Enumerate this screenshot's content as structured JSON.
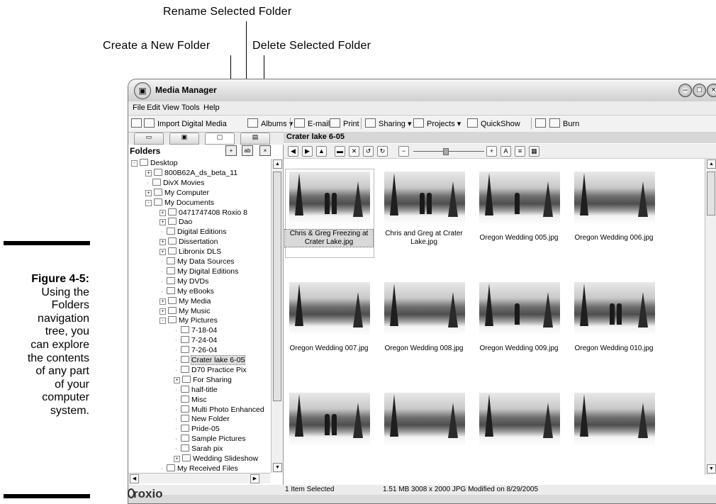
{
  "callouts": {
    "rename": "Rename Selected Folder",
    "create": "Create a New Folder",
    "delete": "Delete Selected Folder"
  },
  "figure": {
    "label": "Figure 4-5:",
    "lines": [
      "Using the",
      "Folders",
      "navigation",
      "tree, you",
      "can explore",
      "the contents",
      "of any part",
      "of your",
      "computer",
      "system."
    ]
  },
  "window": {
    "title": "Media Manager",
    "menu": [
      "File",
      "Edit",
      "View",
      "Tools",
      "Help"
    ],
    "toolbar": [
      "Import Digital Media",
      "Albums",
      "E-mail",
      "Print",
      "Sharing",
      "Projects",
      "QuickShow",
      "Burn"
    ],
    "buttons": {
      "minimize": "–",
      "maximize": "□",
      "close": "×"
    }
  },
  "folders": {
    "header": "Folders",
    "tree": [
      {
        "label": "Desktop",
        "level": 0,
        "exp": "-"
      },
      {
        "label": "800B62A_ds_beta_11",
        "level": 1,
        "exp": "+"
      },
      {
        "label": "DivX Movies",
        "level": 1,
        "exp": ""
      },
      {
        "label": "My Computer",
        "level": 1,
        "exp": "+"
      },
      {
        "label": "My Documents",
        "level": 1,
        "exp": "-"
      },
      {
        "label": "0471747408 Roxio 8",
        "level": 2,
        "exp": "+"
      },
      {
        "label": "Dao",
        "level": 2,
        "exp": "+"
      },
      {
        "label": "Digital Editions",
        "level": 2,
        "exp": ""
      },
      {
        "label": "Dissertation",
        "level": 2,
        "exp": "+"
      },
      {
        "label": "Libronix DLS",
        "level": 2,
        "exp": "+"
      },
      {
        "label": "My Data Sources",
        "level": 2,
        "exp": ""
      },
      {
        "label": "My Digital Editions",
        "level": 2,
        "exp": ""
      },
      {
        "label": "My DVDs",
        "level": 2,
        "exp": ""
      },
      {
        "label": "My eBooks",
        "level": 2,
        "exp": ""
      },
      {
        "label": "My Media",
        "level": 2,
        "exp": "+"
      },
      {
        "label": "My Music",
        "level": 2,
        "exp": "+"
      },
      {
        "label": "My Pictures",
        "level": 2,
        "exp": "-"
      },
      {
        "label": "7-18-04",
        "level": 3,
        "exp": ""
      },
      {
        "label": "7-24-04",
        "level": 3,
        "exp": ""
      },
      {
        "label": "7-26-04",
        "level": 3,
        "exp": ""
      },
      {
        "label": "Crater lake 6-05",
        "level": 3,
        "exp": "",
        "selected": true
      },
      {
        "label": "D70 Practice Pix",
        "level": 3,
        "exp": ""
      },
      {
        "label": "For Sharing",
        "level": 3,
        "exp": "+"
      },
      {
        "label": "half-title",
        "level": 3,
        "exp": ""
      },
      {
        "label": "Misc",
        "level": 3,
        "exp": ""
      },
      {
        "label": "Multi Photo Enhanced",
        "level": 3,
        "exp": ""
      },
      {
        "label": "New Folder",
        "level": 3,
        "exp": ""
      },
      {
        "label": "Pride-05",
        "level": 3,
        "exp": ""
      },
      {
        "label": "Sample Pictures",
        "level": 3,
        "exp": ""
      },
      {
        "label": "Sarah pix",
        "level": 3,
        "exp": ""
      },
      {
        "label": "Wedding Slideshow",
        "level": 3,
        "exp": "+"
      },
      {
        "label": "My Received Files",
        "level": 2,
        "exp": ""
      }
    ]
  },
  "content": {
    "folder_title": "Crater lake 6-05",
    "photos": [
      {
        "caption": "Chris & Greg Freezing at Crater Lake.jpg",
        "selected": true,
        "people": 2
      },
      {
        "caption": "Chris and Greg at Crater Lake.jpg",
        "people": 2
      },
      {
        "caption": "Oregon Wedding 005.jpg",
        "people": 1
      },
      {
        "caption": "Oregon Wedding 006.jpg",
        "people": 0
      },
      {
        "caption": "Oregon Wedding 007.jpg",
        "people": 0
      },
      {
        "caption": "Oregon Wedding 008.jpg",
        "people": 0
      },
      {
        "caption": "Oregon Wedding 009.jpg",
        "people": 1
      },
      {
        "caption": "Oregon Wedding 010.jpg",
        "people": 2
      },
      {
        "caption": "",
        "people": 2
      },
      {
        "caption": "",
        "people": 0
      },
      {
        "caption": "",
        "people": 0
      },
      {
        "caption": "",
        "people": 0
      }
    ]
  },
  "status": {
    "selection": "1 Item Selected",
    "details": "1.51 MB  3008 x 2000 JPG  Modified on 8/29/2005"
  },
  "footer": {
    "logo": "roxio"
  }
}
